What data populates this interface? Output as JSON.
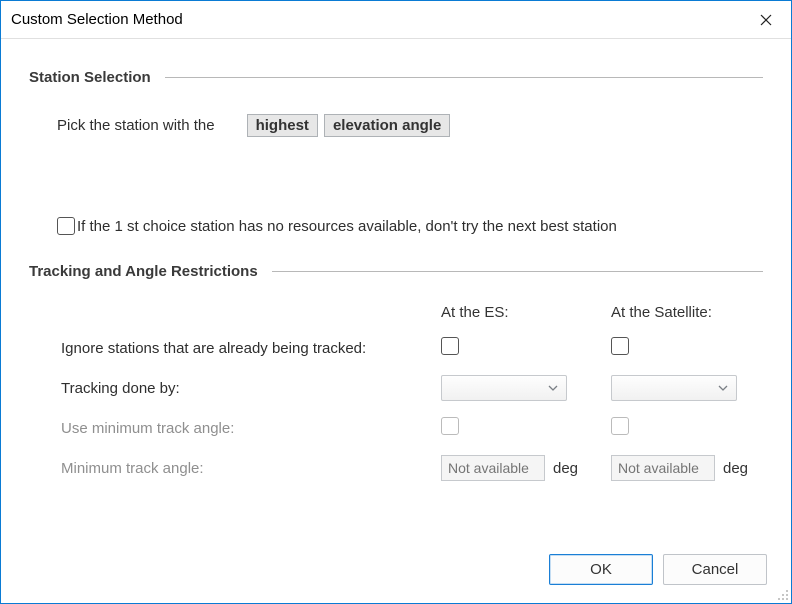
{
  "window": {
    "title": "Custom Selection Method"
  },
  "sections": {
    "station_selection": "Station Selection",
    "tracking": "Tracking and Angle Restrictions"
  },
  "pick": {
    "lead": "Pick the station with the",
    "order": "highest",
    "criterion": "elevation angle"
  },
  "fallback": {
    "label": "If the 1 st choice station has no resources available, don't try the next best station",
    "checked": false
  },
  "columns": {
    "es": "At the ES:",
    "sat": "At the Satellite:"
  },
  "rows": {
    "ignore": {
      "label": "Ignore stations that are already being tracked:",
      "es_checked": false,
      "sat_checked": false
    },
    "tracking_by": {
      "label": "Tracking done by:",
      "es_value": "",
      "sat_value": ""
    },
    "use_min_angle": {
      "label": "Use minimum track angle:",
      "es_checked": false,
      "sat_checked": false,
      "enabled": false
    },
    "min_angle": {
      "label": "Minimum track angle:",
      "es_placeholder": "Not available",
      "sat_placeholder": "Not available",
      "unit": "deg",
      "enabled": false
    }
  },
  "buttons": {
    "ok": "OK",
    "cancel": "Cancel"
  }
}
